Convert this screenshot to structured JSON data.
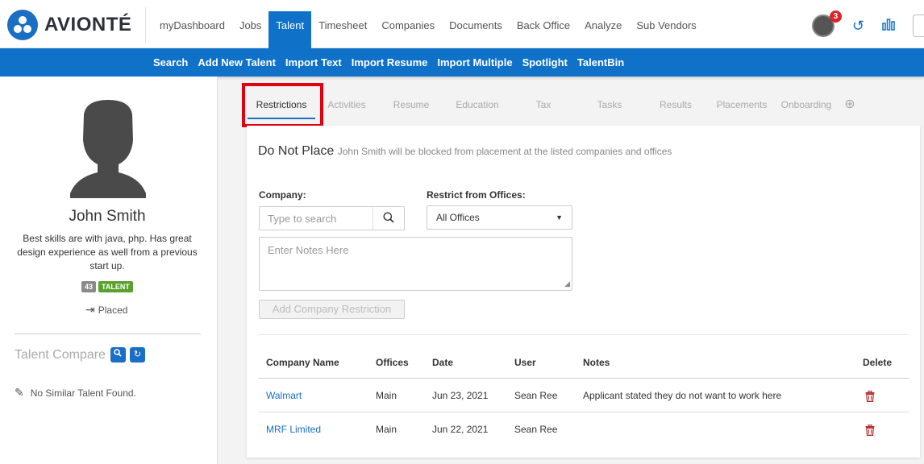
{
  "brand": {
    "name": "AVIONTÉ"
  },
  "nav": {
    "items": [
      "myDashboard",
      "Jobs",
      "Talent",
      "Timesheet",
      "Companies",
      "Documents",
      "Back Office",
      "Analyze",
      "Sub Vendors"
    ],
    "active": "Talent"
  },
  "header": {
    "notification_count": "3"
  },
  "subnav": {
    "items": [
      "Search",
      "Add New Talent",
      "Import Text",
      "Import Resume",
      "Import Multiple",
      "Spotlight",
      "TalentBin"
    ]
  },
  "profile": {
    "name": "John Smith",
    "description": "Best skills are with java, php. Has great design experience as well from a previous start up.",
    "tag_number": "43",
    "tag_label": "TALENT",
    "status": "Placed"
  },
  "compare": {
    "label": "Talent Compare",
    "empty_text": "No Similar Talent Found."
  },
  "tabs": {
    "items": [
      "Restrictions",
      "Activities",
      "Resume",
      "Education",
      "Tax",
      "Tasks",
      "Results",
      "Placements",
      "Onboarding"
    ],
    "active": "Restrictions"
  },
  "restrictions": {
    "title": "Do Not Place",
    "subtitle": "John Smith will be blocked from placement at the listed companies and offices",
    "company_label": "Company:",
    "company_placeholder": "Type to search",
    "offices_label": "Restrict from Offices:",
    "offices_value": "All Offices",
    "notes_placeholder": "Enter Notes Here",
    "add_button": "Add Company Restriction"
  },
  "table": {
    "headers": [
      "Company Name",
      "Offices",
      "Date",
      "User",
      "Notes",
      "Delete"
    ],
    "rows": [
      {
        "company": "Walmart",
        "offices": "Main",
        "date": "Jun 23, 2021",
        "user": "Sean Ree",
        "notes": "Applicant stated they do not want to work here"
      },
      {
        "company": "MRF Limited",
        "offices": "Main",
        "date": "Jun 22, 2021",
        "user": "Sean Ree",
        "notes": ""
      }
    ]
  },
  "colors": {
    "primary": "#0f72c8",
    "highlight": "#e0000f",
    "talent_tag": "#5aa02c",
    "delete": "#b52a2a"
  }
}
